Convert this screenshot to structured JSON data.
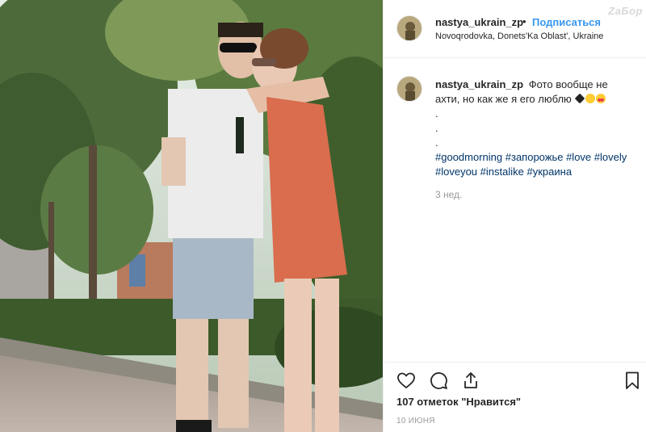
{
  "post": {
    "username": "nastya_ukrain_zp",
    "separator": "•",
    "follow_label": "Подписаться",
    "location": "Novoqrodovka, Donets'Ka Oblast', Ukraine",
    "watermark": "ZaБор"
  },
  "caption": {
    "username": "nastya_ukrain_zp",
    "text": "Фото вообще не ахти, но как же я его люблю",
    "dot1": ".",
    "dot2": ".",
    "dot3": ".",
    "hashtags": [
      "#goodmorning",
      "#запорожье",
      "#love",
      "#lovely",
      "#loveyou",
      "#instalike",
      "#украина"
    ],
    "time_ago": "3 нед."
  },
  "actions": {
    "like_icon": "heart-icon",
    "comment_icon": "comment-icon",
    "share_icon": "share-icon",
    "save_icon": "bookmark-icon"
  },
  "likes_text": "107 отметок \"Нравится\"",
  "date": "10 ИЮНЯ",
  "colors": {
    "follow": "#3897f0",
    "hashtag": "#003569",
    "muted": "#999999",
    "text": "#262626"
  }
}
